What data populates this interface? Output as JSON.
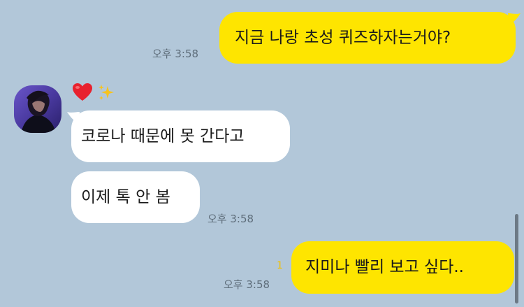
{
  "messages": [
    {
      "id": "m1",
      "direction": "outgoing",
      "text": "지금 나랑 초성 퀴즈하자는거야?",
      "time": "오후 3:58"
    },
    {
      "id": "m2",
      "direction": "incoming",
      "text": "코로나 때문에 못 간다고"
    },
    {
      "id": "m3",
      "direction": "incoming",
      "text": "이제 톡 안 봄",
      "time": "오후 3:58"
    },
    {
      "id": "m4",
      "direction": "outgoing",
      "text": "지미나 빨리 보고 싶다..",
      "time": "오후 3:58",
      "unread_count": "1"
    }
  ],
  "sender": {
    "reaction": {
      "icons": [
        "heart-icon",
        "sparkles-icon"
      ]
    }
  },
  "colors": {
    "background": "#b2c7d9",
    "outgoing_bubble": "#fee500",
    "incoming_bubble": "#ffffff",
    "unread_badge": "#f2c100"
  }
}
